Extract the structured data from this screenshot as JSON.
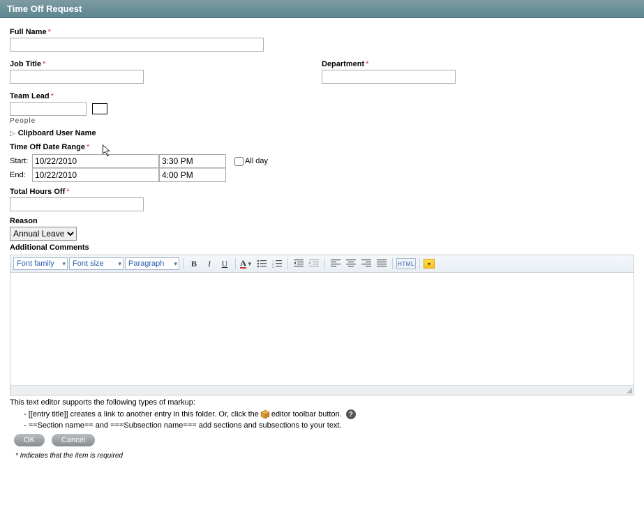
{
  "header": {
    "title": "Time Off Request"
  },
  "fields": {
    "full_name": {
      "label": "Full Name",
      "value": ""
    },
    "job_title": {
      "label": "Job Title",
      "value": ""
    },
    "department": {
      "label": "Department",
      "value": ""
    },
    "team_lead": {
      "label": "Team Lead",
      "value": "",
      "caption": "People"
    },
    "clipboard": {
      "label": "Clipboard User Name"
    },
    "date_range": {
      "label": "Time Off Date Range",
      "start_label": "Start:",
      "end_label": "End:",
      "start_date": "10/22/2010",
      "start_time": "3:30 PM",
      "end_date": "10/22/2010",
      "end_time": "4:00 PM",
      "all_day_label": "All day"
    },
    "total_hours": {
      "label": "Total Hours Off",
      "value": ""
    },
    "reason": {
      "label": "Reason",
      "selected": "Annual Leave"
    },
    "comments": {
      "label": "Additional Comments"
    }
  },
  "toolbar": {
    "font_family_label": "Font family",
    "font_size_label": "Font size",
    "paragraph_label": "Paragraph",
    "html_label": "HTML"
  },
  "markup": {
    "intro": "This text editor supports the following types of markup:",
    "line1a": "- [[entry title]] creates a link to another entry in this folder. Or, click the ",
    "line1b": " editor toolbar button.",
    "line2": "- ==Section name== and ===Subsection name=== add sections and subsections to your text."
  },
  "buttons": {
    "ok": "OK",
    "cancel": "Cancel"
  },
  "footnote": "* Indicates that the item is required"
}
